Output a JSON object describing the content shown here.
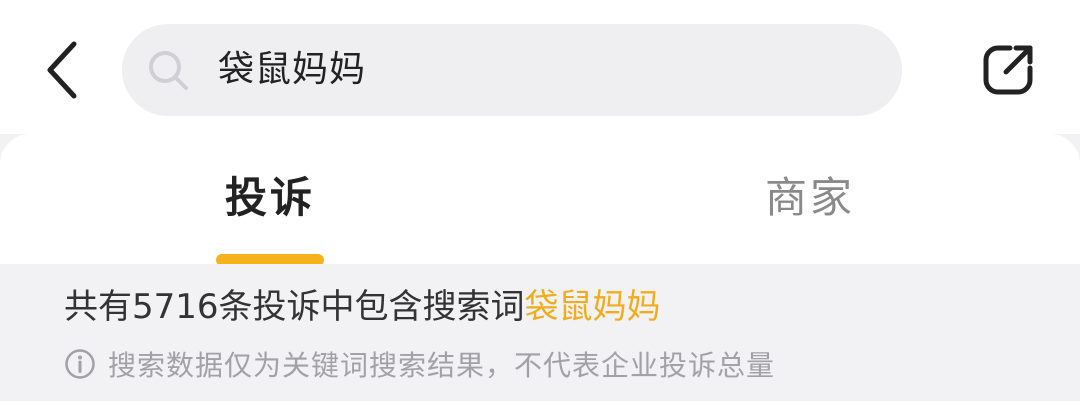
{
  "search": {
    "query": "袋鼠妈妈",
    "icon": "search-icon"
  },
  "nav": {
    "back_icon": "chevron-left-icon",
    "share_icon": "share-external-icon"
  },
  "tabs": [
    {
      "label": "投诉",
      "active": true
    },
    {
      "label": "商家",
      "active": false
    }
  ],
  "results": {
    "count_prefix": "共有5716条投诉中包含搜索词",
    "keyword": "袋鼠妈妈",
    "disclaimer": "搜索数据仅为关键词搜索结果，不代表企业投诉总量",
    "info_icon": "info-circle-icon"
  },
  "colors": {
    "accent": "#f5b21d",
    "keyword": "#f0ad1e",
    "page_bg": "#f2f2f4",
    "search_bg": "#efeff1"
  }
}
